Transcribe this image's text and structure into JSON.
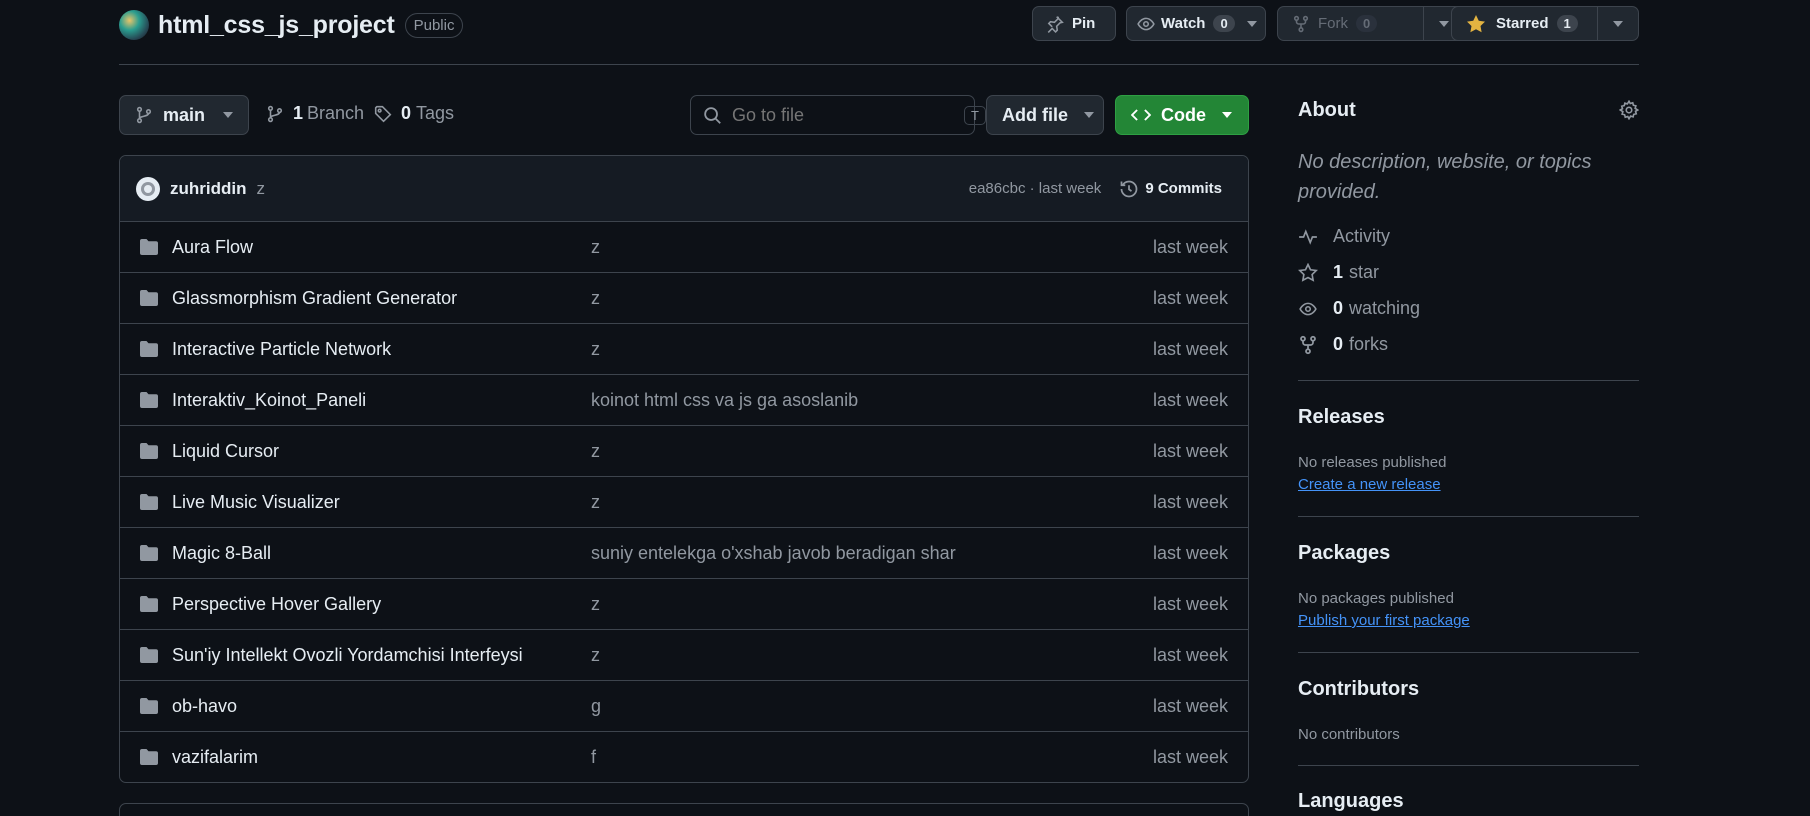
{
  "repo": {
    "name": "html_css_js_project",
    "visibility": "Public"
  },
  "header_actions": {
    "pin": "Pin",
    "watch": {
      "label": "Watch",
      "count": "0"
    },
    "fork": {
      "label": "Fork",
      "count": "0"
    },
    "star": {
      "label": "Starred",
      "count": "1"
    }
  },
  "toolbar": {
    "branch": "main",
    "branches": {
      "count": "1",
      "label": "Branch"
    },
    "tags": {
      "count": "0",
      "label": "Tags"
    },
    "search": {
      "placeholder": "Go to file",
      "shortcut": "T"
    },
    "add_file": "Add file",
    "code": "Code"
  },
  "last_commit": {
    "author": "zuhriddin",
    "message": "z",
    "meta": "ea86cbc · last week",
    "commits": "9 Commits"
  },
  "files": [
    {
      "name": "Aura Flow",
      "message": "z",
      "time": "last week"
    },
    {
      "name": "Glassmorphism Gradient Generator",
      "message": "z",
      "time": "last week"
    },
    {
      "name": "Interactive Particle Network",
      "message": "z",
      "time": "last week"
    },
    {
      "name": "Interaktiv_Koinot_Paneli",
      "message": "koinot html css va js ga asoslanib",
      "time": "last week"
    },
    {
      "name": "Liquid Cursor",
      "message": "z",
      "time": "last week"
    },
    {
      "name": "Live Music Visualizer",
      "message": "z",
      "time": "last week"
    },
    {
      "name": "Magic 8-Ball",
      "message": "suniy entelekga o'xshab javob beradigan shar",
      "time": "last week"
    },
    {
      "name": "Perspective Hover Gallery",
      "message": "z",
      "time": "last week"
    },
    {
      "name": "Sun'iy Intellekt Ovozli Yordamchisi Interfeysi",
      "message": "z",
      "time": "last week"
    },
    {
      "name": "ob-havo",
      "message": "g",
      "time": "last week"
    },
    {
      "name": "vazifalarim",
      "message": "f",
      "time": "last week"
    }
  ],
  "about": {
    "title": "About",
    "description": "No description, website, or topics provided.",
    "activity": "Activity",
    "stars": {
      "count": "1",
      "label": "star"
    },
    "watching": {
      "count": "0",
      "label": "watching"
    },
    "forks": {
      "count": "0",
      "label": "forks"
    }
  },
  "releases": {
    "title": "Releases",
    "empty": "No releases published",
    "link": "Create a new release"
  },
  "packages": {
    "title": "Packages",
    "empty": "No packages published",
    "link": "Publish your first package"
  },
  "contributors": {
    "title": "Contributors",
    "empty": "No contributors"
  },
  "languages": {
    "title": "Languages"
  },
  "colors": {
    "bg": "#0d1117",
    "border": "#3d444d",
    "accent_green": "#238636",
    "link": "#4493f8",
    "star": "#e3b341"
  }
}
